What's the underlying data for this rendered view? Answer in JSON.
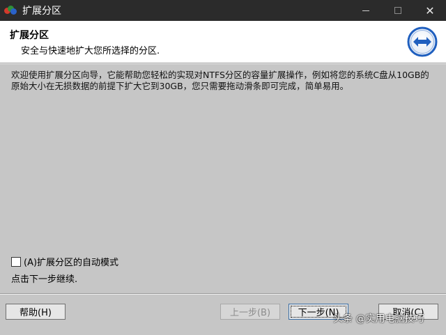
{
  "window": {
    "title": "扩展分区"
  },
  "header": {
    "title": "扩展分区",
    "subtitle": "安全与快速地扩大您所选择的分区."
  },
  "intro": {
    "text": "欢迎使用扩展分区向导，它能帮助您轻松的实现对NTFS分区的容量扩展操作，例如将您的系统C盘从10GB的原始大小在无损数据的前提下扩大它到30GB，您只需要拖动滑条即可完成，简单易用。"
  },
  "options": {
    "auto_mode_label": "(A)扩展分区的自动模式",
    "auto_mode_checked": false
  },
  "hint": "点击下一步继续.",
  "buttons": {
    "help": "帮助(H)",
    "prev": "上一步(B)",
    "next": "下一步(N)",
    "cancel": "取消(C)"
  },
  "watermark": "头条 @实用电脑技巧",
  "icons": {
    "app": "app-icon",
    "header_logo": "expand-arrows-icon",
    "minimize": "minimize-icon",
    "maximize": "maximize-icon",
    "close": "close-icon"
  },
  "colors": {
    "titlebar": "#2b2b2b",
    "body": "#c6c6c6",
    "header": "#ffffff",
    "logo_blue": "#1f5fbf"
  }
}
